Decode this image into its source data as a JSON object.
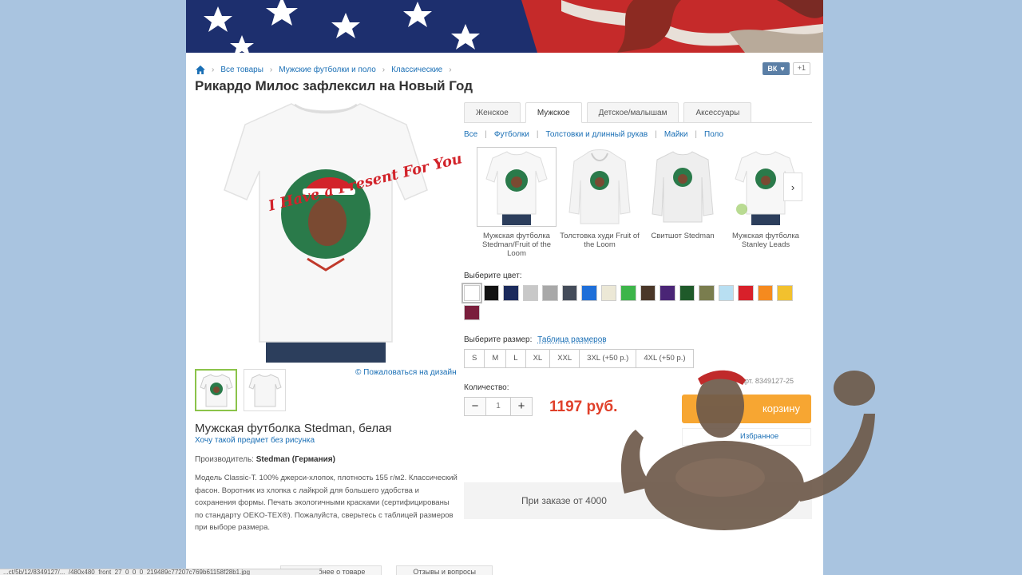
{
  "breadcrumb": {
    "items": [
      "Все товары",
      "Мужские футболки и поло",
      "Классические"
    ]
  },
  "social": {
    "vk": "ВК",
    "plus": "+1"
  },
  "product": {
    "title": "Рикардо Милос зафлексил на Новый Год",
    "name": "Мужская футболка Stedman, белая",
    "no_print_link": "Хочу такой предмет без рисунка",
    "complain_link": "© Пожаловаться на дизайн",
    "maker_label": "Производитель:",
    "maker_value": "Stedman (Германия)",
    "description": "Модель Classic-T. 100% джерси-хлопок, плотность 155 г/м2. Классический фасон. Воротник из хлопка с лайкрой для большего удобства и сохранения формы. Печать экологичными красками (сертифицированы по стандарту OEKO-TEX®). Пожалуйста, сверьтесь с таблицей размеров при выборе размера.",
    "print_text": "I Have a Present For You"
  },
  "tabs": [
    "Женское",
    "Мужское",
    "Детское/малышам",
    "Аксессуары"
  ],
  "active_tab": "Мужское",
  "subcats": [
    "Все",
    "Футболки",
    "Толстовки и длинный рукав",
    "Майки",
    "Поло"
  ],
  "products": [
    {
      "name": "Мужская футболка Stedman/Fruit of the Loom"
    },
    {
      "name": "Толстовка худи Fruit of the Loom"
    },
    {
      "name": "Свитшот Stedman"
    },
    {
      "name": "Мужская футболка Stanley Leads"
    }
  ],
  "color_label": "Выберите цвет:",
  "colors": [
    "#ffffff",
    "#111111",
    "#1b2a5c",
    "#c8c8c8",
    "#a8a8a8",
    "#444c5a",
    "#1e6fd9",
    "#ece8d6",
    "#3db54a",
    "#4a3728",
    "#4a2576",
    "#1f5a2a",
    "#7a7d4e",
    "#b8dff2",
    "#d8202a",
    "#f58a1f",
    "#f2c12e",
    "#7a1e3c"
  ],
  "size_label": "Выберите размер:",
  "size_table_link": "Таблица размеров",
  "sizes": [
    "S",
    "M",
    "L",
    "XL",
    "XXL",
    "3XL (+50 р.)",
    "4XL (+50 р.)"
  ],
  "qty_label": "Количество:",
  "qty_minus": "−",
  "qty_value": "1",
  "qty_plus": "+",
  "price": "1197 руб.",
  "article": "Арт. 8349127-25",
  "cart_button": "корзину",
  "favorites": "Избранное",
  "bulk_order": "При заказе от 4000",
  "bottom_buttons": [
    "Подробнее о товаре",
    "Отзывы и вопросы"
  ],
  "status_url": "...ct/5b/12/8349127/..._/480x480_front_27_0_0_0_219489c77207c769b61158f28b1.jpg"
}
